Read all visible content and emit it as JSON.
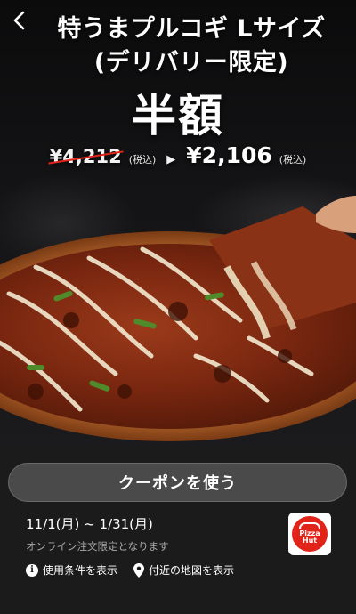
{
  "nav": {
    "back_icon": "chevron-left-icon"
  },
  "promo": {
    "title_line1": "特うまプルコギ Lサイズ",
    "title_line2": "(デリバリー限定)",
    "headline": "半額",
    "original_price": "¥4,212",
    "original_tax": "(税込)",
    "arrow": "▶",
    "sale_price": "¥2,106",
    "sale_tax": "(税込)"
  },
  "coupon": {
    "button_label": "クーポンを使う",
    "period": "11/1(月) ~ 1/31(月)",
    "note": "オンライン注文限定となります",
    "terms_label": "使用条件を表示",
    "map_label": "付近の地図を表示"
  },
  "brand": {
    "logo_text_line1": "Pizza",
    "logo_text_line2": "Hut"
  },
  "colors": {
    "accent_red": "#e2231a",
    "panel_bg": "#1b1b1b",
    "button_bg": "#4a4a4a"
  }
}
